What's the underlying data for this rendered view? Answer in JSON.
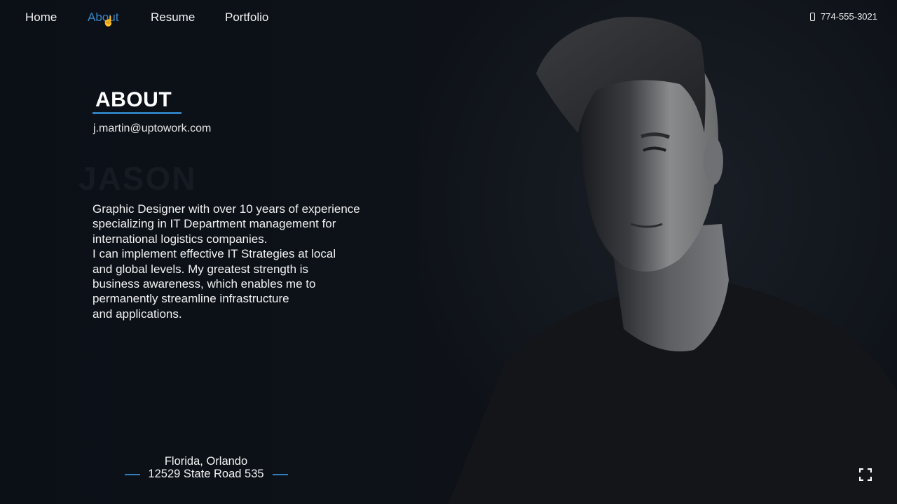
{
  "nav": {
    "items": [
      {
        "label": "Home"
      },
      {
        "label": "About"
      },
      {
        "label": "Resume"
      },
      {
        "label": "Portfolio"
      }
    ],
    "active": "About",
    "phone": "774-555-3021"
  },
  "about": {
    "title": "ABOUT",
    "email": "j.martin@uptowork.com",
    "bio_lines": [
      "Graphic Designer with over 10 years of experience",
      "specializing in IT Department management for",
      "international logistics companies.",
      "I can implement effective IT Strategies at local",
      "and global levels. My greatest strength is",
      "business awareness, which enables me to",
      "permanently streamline infrastructure",
      "and applications."
    ]
  },
  "address": {
    "city": "Florida, Orlando",
    "street": "12529 State Road 535"
  },
  "colors": {
    "accent": "#2f7fbf",
    "background": "#0d1117"
  },
  "icons": {
    "phone": "phone-icon",
    "fullscreen": "fullscreen-icon"
  }
}
